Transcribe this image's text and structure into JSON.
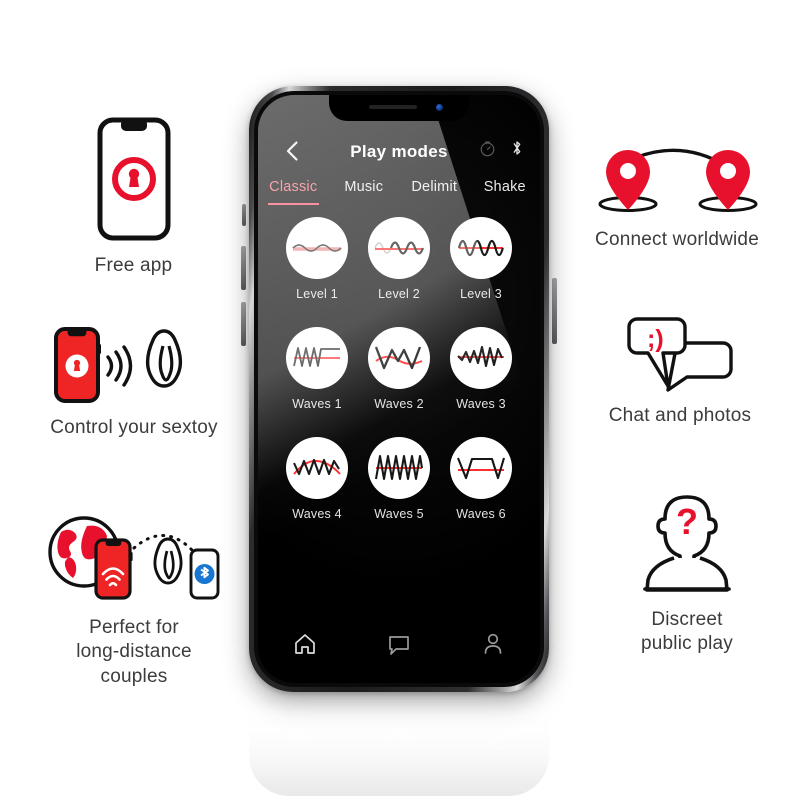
{
  "features": {
    "left": [
      {
        "id": "free-app",
        "caption": "Free app",
        "icon": "phone-with-logo-icon"
      },
      {
        "id": "control-sextoy",
        "caption": "Control your sextoy",
        "icon": "phone-signal-toy-icon"
      },
      {
        "id": "long-distance",
        "caption": "Perfect for\nlong-distance\ncouples",
        "icon": "globe-phone-toy-bluetooth-icon"
      }
    ],
    "right": [
      {
        "id": "connect-worldwide",
        "caption": "Connect worldwide",
        "icon": "two-map-pins-icon"
      },
      {
        "id": "chat-and-photos",
        "caption": "Chat and photos",
        "icon": "speech-bubbles-icon",
        "emoticon": ";)"
      },
      {
        "id": "discreet-public-play",
        "caption": "Discreet\npublic play",
        "icon": "anonymous-person-icon",
        "glyph": "?"
      }
    ]
  },
  "phone": {
    "app": {
      "title": "Play modes",
      "back_icon": "chevron-left-icon",
      "header_icons": [
        "timer-icon",
        "bluetooth-icon"
      ],
      "tabs": [
        {
          "label": "Classic",
          "active": true
        },
        {
          "label": "Music",
          "active": false
        },
        {
          "label": "Delimit",
          "active": false
        },
        {
          "label": "Shake",
          "active": false
        }
      ],
      "modes": [
        {
          "label": "Level 1",
          "wave": "sine-low"
        },
        {
          "label": "Level 2",
          "wave": "sine-medium"
        },
        {
          "label": "Level 3",
          "wave": "sine-high"
        },
        {
          "label": "Waves 1",
          "wave": "zigzag-plateau"
        },
        {
          "label": "Waves 2",
          "wave": "big-vw"
        },
        {
          "label": "Waves 3",
          "wave": "small-then-spikes"
        },
        {
          "label": "Waves 4",
          "wave": "zigzag-arc"
        },
        {
          "label": "Waves 5",
          "wave": "triangle-uniform"
        },
        {
          "label": "Waves 6",
          "wave": "trapezoid-pulse"
        }
      ],
      "bottom_nav": [
        {
          "id": "home",
          "icon": "home-icon"
        },
        {
          "id": "chat",
          "icon": "chat-bubble-icon"
        },
        {
          "id": "profile",
          "icon": "person-icon"
        }
      ]
    }
  },
  "colors": {
    "accent_red": "#e8112d",
    "tab_active": "#f4697a",
    "tab_underline": "#ef4f63",
    "wave_red": "#ff2b2b",
    "bluetooth_blue": "#1877d2",
    "caption_text": "#3c3c3c",
    "screen_bg": "#000000"
  }
}
